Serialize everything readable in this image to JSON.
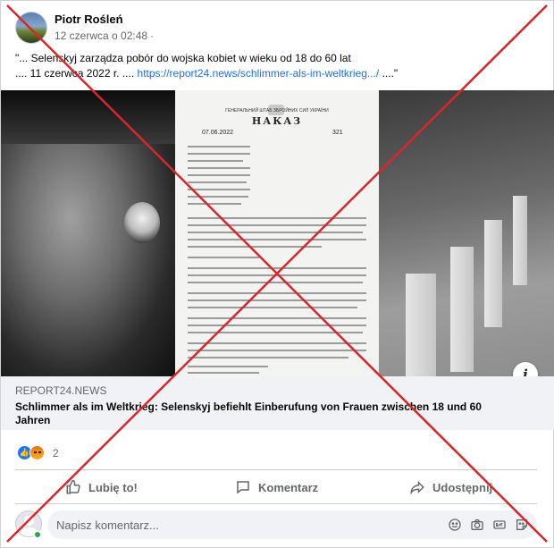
{
  "post": {
    "author": "Piotr Rośleń",
    "date": "12 czerwca o 02:48",
    "privacy_dot": "·",
    "text_line1": "\"... Selenskyj zarządza pobór do wojska kobiet w wieku od 18 do 60 lat",
    "text_line2_prefix": ".... 11 czerwca 2022 r. .... ",
    "text_link": "https://report24.news/schlimmer-als-im-weltkrieg.../",
    "text_line2_suffix": " ....\""
  },
  "image": {
    "document_header": "ГЕНЕРАЛЬНИЙ ШТАБ ЗБРОЙНИХ СИЛ УКРАЇНИ",
    "document_title": "НАКАЗ",
    "document_date": "07.06.2022",
    "document_number": "321",
    "info_button_label": "i"
  },
  "link_preview": {
    "domain": "REPORT24.NEWS",
    "title": "Schlimmer als im Weltkrieg: Selenskyj befiehlt Einberufung von Frauen zwischen 18 und 60 Jahren"
  },
  "reactions": {
    "count": "2",
    "types": [
      "like-icon",
      "angry-icon"
    ]
  },
  "actions": {
    "like_label": "Lubię to!",
    "comment_label": "Komentarz",
    "share_label": "Udostępnij"
  },
  "comment": {
    "placeholder": "Napisz komentarz..."
  },
  "overlay": {
    "cross_color": "#d8262b"
  },
  "colors": {
    "link": "#216fdb",
    "like_blue": "#1877f2",
    "muted": "#65676b",
    "link_box_bg": "#f0f2f5"
  }
}
